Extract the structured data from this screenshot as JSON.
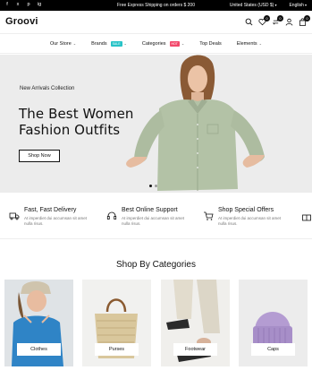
{
  "topbar": {
    "social": [
      "f",
      "x",
      "p",
      "ig"
    ],
    "promo": "Free Express Shipping on orders $ 200",
    "currency": "United States (USD $)",
    "language": "English"
  },
  "header": {
    "logo": "Groovi",
    "badges": {
      "wishlist": "0",
      "compare": "0",
      "cart": "0"
    }
  },
  "nav": {
    "items": [
      {
        "label": "Our Store"
      },
      {
        "label": "Brands",
        "tag": "SALE",
        "tag_color": "#27c3c7"
      },
      {
        "label": "Categories",
        "tag": "HOT",
        "tag_color": "#f2486b"
      },
      {
        "label": "Top Deals"
      },
      {
        "label": "Elements"
      }
    ]
  },
  "hero": {
    "subtitle": "New Arrivals Collection",
    "title_line1": "The Best Women",
    "title_line2": "Fashion Outfits",
    "button": "Shop Now"
  },
  "features": [
    {
      "title": "Fast, Fast Delivery",
      "desc": "At imperdiet dui accumsan sit amet nulla risus."
    },
    {
      "title": "Best Online Support",
      "desc": "At imperdiet dui accumsan sit amet nulla risus."
    },
    {
      "title": "Shop Special Offers",
      "desc": "At imperdiet dui accumsan sit amet nulla risus."
    }
  ],
  "categories": {
    "title": "Shop By Categories",
    "items": [
      {
        "label": "Clothes"
      },
      {
        "label": "Purses"
      },
      {
        "label": "Footwear"
      },
      {
        "label": "Caps"
      }
    ]
  },
  "colors": {
    "topbar_bg": "#000000",
    "hero_bg": "#ececec",
    "sale_tag": "#27c3c7",
    "hot_tag": "#f2486b"
  }
}
